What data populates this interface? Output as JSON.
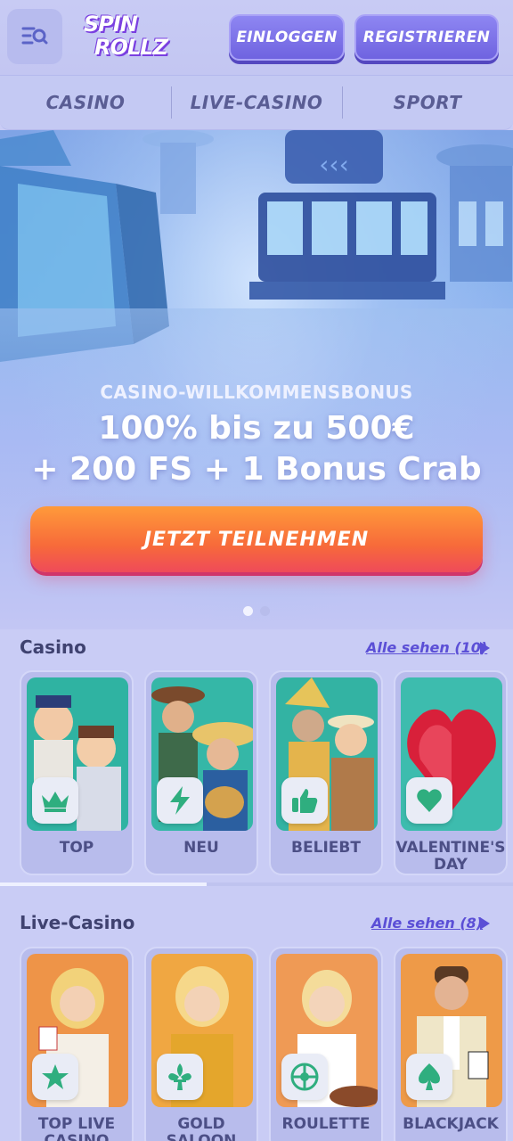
{
  "header": {
    "logo_line1": "SPIN",
    "logo_line2": "ROLLZ",
    "login_label": "EINLOGGEN",
    "register_label": "REGISTRIEREN"
  },
  "nav": {
    "tabs": [
      {
        "label": "CASINO"
      },
      {
        "label": "LIVE-CASINO"
      },
      {
        "label": "SPORT"
      }
    ]
  },
  "hero": {
    "subtitle": "CASINO-WILLKOMMENSBONUS",
    "line1": "100% bis zu 500€",
    "line2": "+ 200 FS + 1 Bonus Crab",
    "cta_label": "JETZT TEILNEHMEN",
    "slides_total": 2,
    "slide_active": 1
  },
  "casino": {
    "title": "Casino",
    "see_all": "Alle sehen (10)",
    "cards": [
      {
        "label": "TOP",
        "icon": "crown-icon",
        "colors": [
          "#2fb7a6",
          "#1a8f86"
        ]
      },
      {
        "label": "NEU",
        "icon": "lightning-icon",
        "colors": [
          "#3cb9a9",
          "#207e76"
        ]
      },
      {
        "label": "BELIEBT",
        "icon": "thumbs-up-icon",
        "colors": [
          "#38b5a4",
          "#1d8c80"
        ]
      },
      {
        "label": "VALENTINE'S DAY",
        "icon": "heart-icon",
        "colors": [
          "#46bfb1",
          "#2a9488"
        ]
      }
    ]
  },
  "live_casino": {
    "title": "Live-Casino",
    "see_all": "Alle sehen (8)",
    "cards": [
      {
        "label": "TOP LIVE CASINO",
        "icon": "star-icon",
        "colors": [
          "#f3a24b",
          "#e0702a"
        ]
      },
      {
        "label": "GOLD SALOON",
        "icon": "fleur-de-lis-icon",
        "colors": [
          "#f5b04a",
          "#e38624"
        ]
      },
      {
        "label": "ROULETTE",
        "icon": "roulette-icon",
        "colors": [
          "#f1a259",
          "#dd7a3a"
        ]
      },
      {
        "label": "BLACKJACK",
        "icon": "spade-icon",
        "colors": [
          "#f2a04a",
          "#de6f2a"
        ]
      }
    ]
  },
  "colors": {
    "accent": "#5b4fd6",
    "badge_icon": "#2fae7f",
    "cta_top": "#ff9a3a",
    "cta_bottom": "#ef4a5a"
  }
}
